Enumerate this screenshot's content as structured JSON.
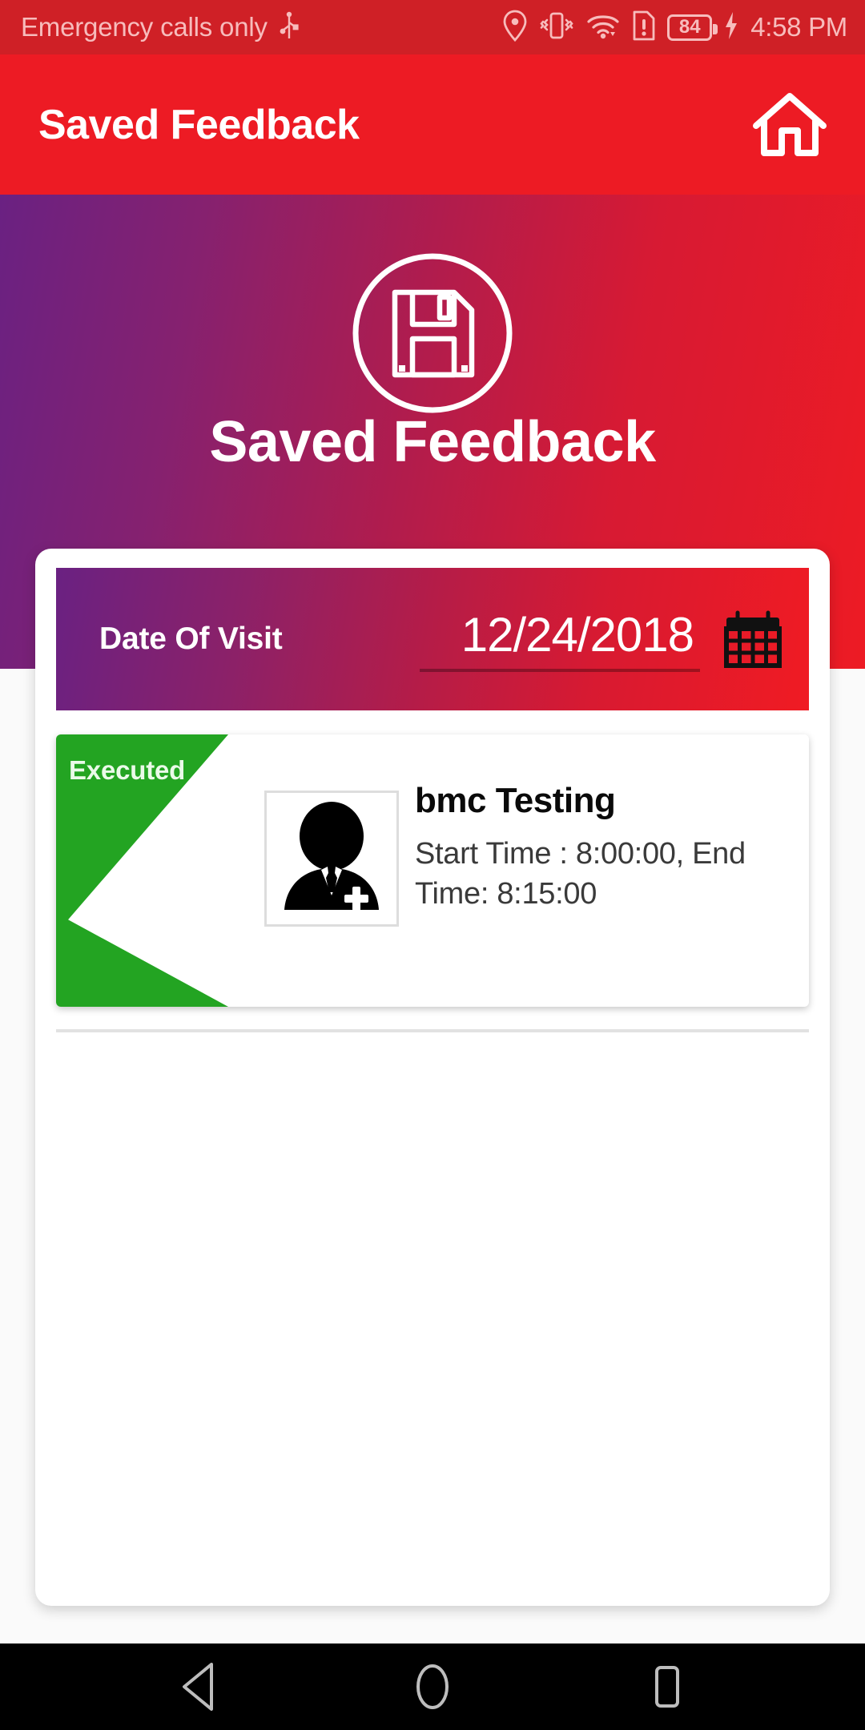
{
  "status_bar": {
    "carrier": "Emergency calls only",
    "clock": "4:58 PM",
    "battery_level": "84",
    "icons": [
      "usb-icon",
      "location-pin-icon",
      "vibrate-icon",
      "wifi-icon",
      "sim-alert-icon",
      "battery-icon",
      "charging-bolt-icon"
    ],
    "background_color": "#cf2026",
    "text_color": "#f7bcbc"
  },
  "app_bar": {
    "title": "Saved Feedback",
    "home_icon": "home-icon",
    "background_color": "#ed1b24"
  },
  "header": {
    "emblem_icon": "floppy-disk-save-icon",
    "title": "Saved Feedback",
    "gradient_from": "#6a2182",
    "gradient_to": "#ed1b24"
  },
  "date_field": {
    "label": "Date Of Visit",
    "value": "12/24/2018",
    "calendar_icon": "calendar-icon"
  },
  "feedback_items": [
    {
      "status": "Executed",
      "status_color": "#23a422",
      "avatar_icon": "doctor-avatar-icon",
      "title": "bmc  Testing",
      "details": "Start Time : 8:00:00, End Time: 8:15:00"
    }
  ],
  "nav_bar": {
    "back_icon": "back-triangle-icon",
    "home_icon": "home-circle-icon",
    "recents_icon": "recents-square-icon",
    "background_color": "#000000"
  }
}
